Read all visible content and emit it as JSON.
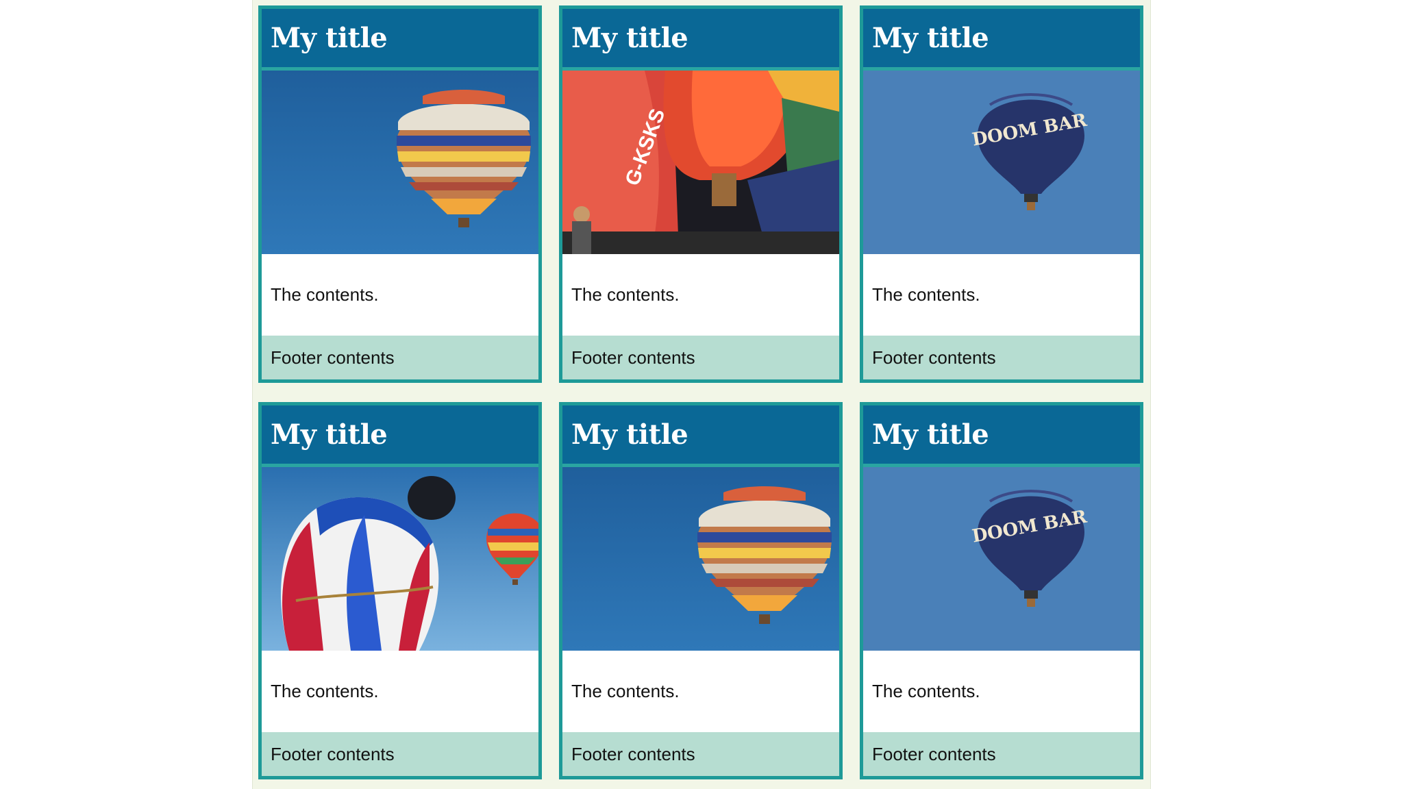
{
  "cards": [
    {
      "title": "My title",
      "image_icon": "striped-balloon-image",
      "content": "The contents.",
      "footer": "Footer contents"
    },
    {
      "title": "My title",
      "image_icon": "red-balloons-crowd-image",
      "content": "The contents.",
      "footer": "Footer contents",
      "image_text": "G-KSKS"
    },
    {
      "title": "My title",
      "image_icon": "doom-bar-balloon-image",
      "content": "The contents.",
      "footer": "Footer contents",
      "image_text": "DOOM BAR"
    },
    {
      "title": "My title",
      "image_icon": "blue-white-balloons-image",
      "content": "The contents.",
      "footer": "Footer contents"
    },
    {
      "title": "My title",
      "image_icon": "striped-balloon-image",
      "content": "The contents.",
      "footer": "Footer contents"
    },
    {
      "title": "My title",
      "image_icon": "doom-bar-balloon-image",
      "content": "The contents.",
      "footer": "Footer contents",
      "image_text": "DOOM BAR"
    }
  ],
  "colors": {
    "header": "#0a6896",
    "border": "#1e9a98",
    "footer": "#b6ddd1",
    "page_background": "#f2f6e7"
  }
}
